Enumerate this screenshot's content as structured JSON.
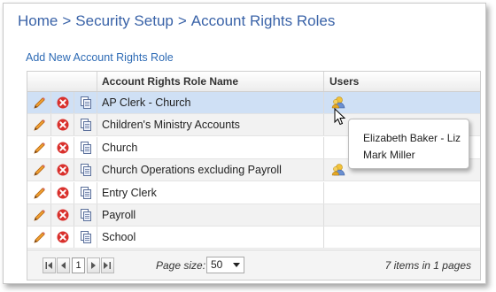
{
  "breadcrumb": {
    "items": [
      "Home",
      "Security Setup",
      "Account Rights Roles"
    ],
    "separator": ">"
  },
  "add_link": "Add New Account Rights Role",
  "grid": {
    "columns": {
      "name": "Account Rights Role Name",
      "users": "Users"
    },
    "rows": [
      {
        "name": "AP Clerk - Church",
        "has_users": true,
        "selected": true
      },
      {
        "name": "Children's Ministry Accounts",
        "has_users": false
      },
      {
        "name": "Church",
        "has_users": false
      },
      {
        "name": "Church Operations excluding Payroll",
        "has_users": true
      },
      {
        "name": "Entry Clerk",
        "has_users": false
      },
      {
        "name": "Payroll",
        "has_users": false
      },
      {
        "name": "School",
        "has_users": false
      }
    ],
    "icons": {
      "edit": "pencil-icon",
      "delete": "delete-circle-icon",
      "copy": "copy-document-icon",
      "users": "user-group-icon"
    }
  },
  "tooltip": {
    "users": [
      "Elizabeth Baker - Liz",
      "Mark Miller"
    ]
  },
  "pager": {
    "current_page": "1",
    "page_size_label": "Page size:",
    "page_size_value": "50",
    "info": "7 items in 1 pages"
  },
  "colors": {
    "link": "#2e6bb5",
    "breadcrumb": "#3a63a8",
    "selected_row": "#cfe0f5",
    "delete_icon": "#d9302c",
    "edit_icon": "#e8821e"
  }
}
